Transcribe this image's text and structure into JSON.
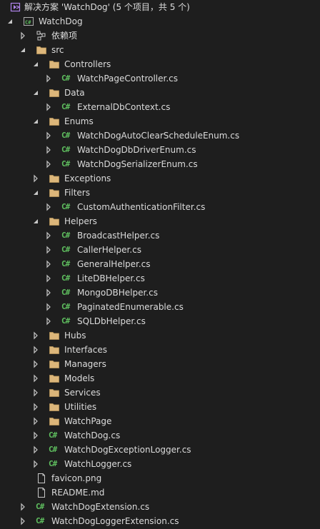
{
  "solution_label": "解决方案 'WatchDog' (5 个项目，共 5 个)",
  "project_label": "WatchDog",
  "dependencies_label": "依赖项",
  "nodes": [
    {
      "label": "src",
      "type": "folder",
      "level": 2,
      "expanded": true
    },
    {
      "label": "Controllers",
      "type": "folder",
      "level": 3,
      "expanded": true
    },
    {
      "label": "WatchPageController.cs",
      "type": "cs",
      "level": 4,
      "expanded": false
    },
    {
      "label": "Data",
      "type": "folder",
      "level": 3,
      "expanded": true
    },
    {
      "label": "ExternalDbContext.cs",
      "type": "cs",
      "level": 4,
      "expanded": false
    },
    {
      "label": "Enums",
      "type": "folder",
      "level": 3,
      "expanded": true
    },
    {
      "label": "WatchDogAutoClearScheduleEnum.cs",
      "type": "cs",
      "level": 4,
      "expanded": false
    },
    {
      "label": "WatchDogDbDriverEnum.cs",
      "type": "cs",
      "level": 4,
      "expanded": false
    },
    {
      "label": "WatchDogSerializerEnum.cs",
      "type": "cs",
      "level": 4,
      "expanded": false
    },
    {
      "label": "Exceptions",
      "type": "folder",
      "level": 3,
      "expanded": false
    },
    {
      "label": "Filters",
      "type": "folder",
      "level": 3,
      "expanded": true
    },
    {
      "label": "CustomAuthenticationFilter.cs",
      "type": "cs",
      "level": 4,
      "expanded": false
    },
    {
      "label": "Helpers",
      "type": "folder",
      "level": 3,
      "expanded": true
    },
    {
      "label": "BroadcastHelper.cs",
      "type": "cs",
      "level": 4,
      "expanded": false
    },
    {
      "label": "CallerHelper.cs",
      "type": "cs",
      "level": 4,
      "expanded": false
    },
    {
      "label": "GeneralHelper.cs",
      "type": "cs",
      "level": 4,
      "expanded": false
    },
    {
      "label": "LiteDBHelper.cs",
      "type": "cs",
      "level": 4,
      "expanded": false
    },
    {
      "label": "MongoDBHelper.cs",
      "type": "cs",
      "level": 4,
      "expanded": false
    },
    {
      "label": "PaginatedEnumerable.cs",
      "type": "cs",
      "level": 4,
      "expanded": false
    },
    {
      "label": "SQLDbHelper.cs",
      "type": "cs",
      "level": 4,
      "expanded": false
    },
    {
      "label": "Hubs",
      "type": "folder",
      "level": 3,
      "expanded": false
    },
    {
      "label": "Interfaces",
      "type": "folder",
      "level": 3,
      "expanded": false
    },
    {
      "label": "Managers",
      "type": "folder",
      "level": 3,
      "expanded": false
    },
    {
      "label": "Models",
      "type": "folder",
      "level": 3,
      "expanded": false
    },
    {
      "label": "Services",
      "type": "folder",
      "level": 3,
      "expanded": false
    },
    {
      "label": "Utilities",
      "type": "folder",
      "level": 3,
      "expanded": false
    },
    {
      "label": "WatchPage",
      "type": "folder",
      "level": 3,
      "expanded": false
    },
    {
      "label": "WatchDog.cs",
      "type": "cs",
      "level": 3,
      "expanded": false
    },
    {
      "label": "WatchDogExceptionLogger.cs",
      "type": "cs",
      "level": 3,
      "expanded": false
    },
    {
      "label": "WatchLogger.cs",
      "type": "cs",
      "level": 3,
      "expanded": false
    },
    {
      "label": "favicon.png",
      "type": "file",
      "level": 2,
      "expanded": null
    },
    {
      "label": "README.md",
      "type": "file",
      "level": 2,
      "expanded": null
    },
    {
      "label": "WatchDogExtension.cs",
      "type": "cs",
      "level": 2,
      "expanded": false
    },
    {
      "label": "WatchDogLoggerExtension.cs",
      "type": "cs",
      "level": 2,
      "expanded": false
    }
  ],
  "cs_glyph": "C#",
  "icons": {
    "solution": "solution-icon",
    "project": "csharp-project-icon",
    "dependencies": "dependencies-icon",
    "folder": "folder-icon",
    "cs": "csharp-file-icon",
    "file": "file-icon"
  },
  "colors": {
    "background": "#1e1e1e",
    "text": "#dcdcdc",
    "caret": "#c8c8c8",
    "folder": "#dcb67a",
    "csharp": "#5fbf5f",
    "solution": "#b084eb"
  }
}
